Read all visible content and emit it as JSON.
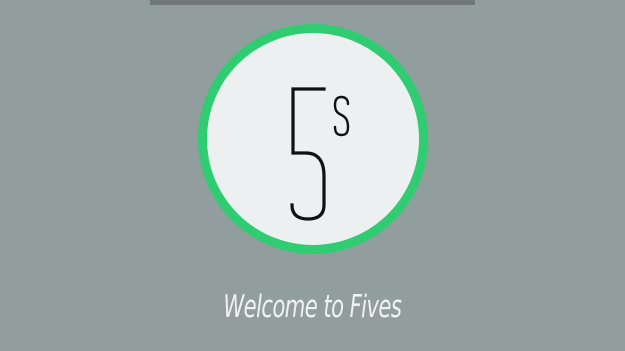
{
  "app": {
    "timer_value": "5",
    "timer_unit": "s",
    "welcome_text": "Welcome to Fives"
  },
  "colors": {
    "background": "#929e9e",
    "status_bar": "#6f7777",
    "ring_accent": "#2fcc71",
    "ring_fill": "#ecf0f1",
    "numeral": "#111111",
    "welcome_text": "#eef2f3"
  }
}
